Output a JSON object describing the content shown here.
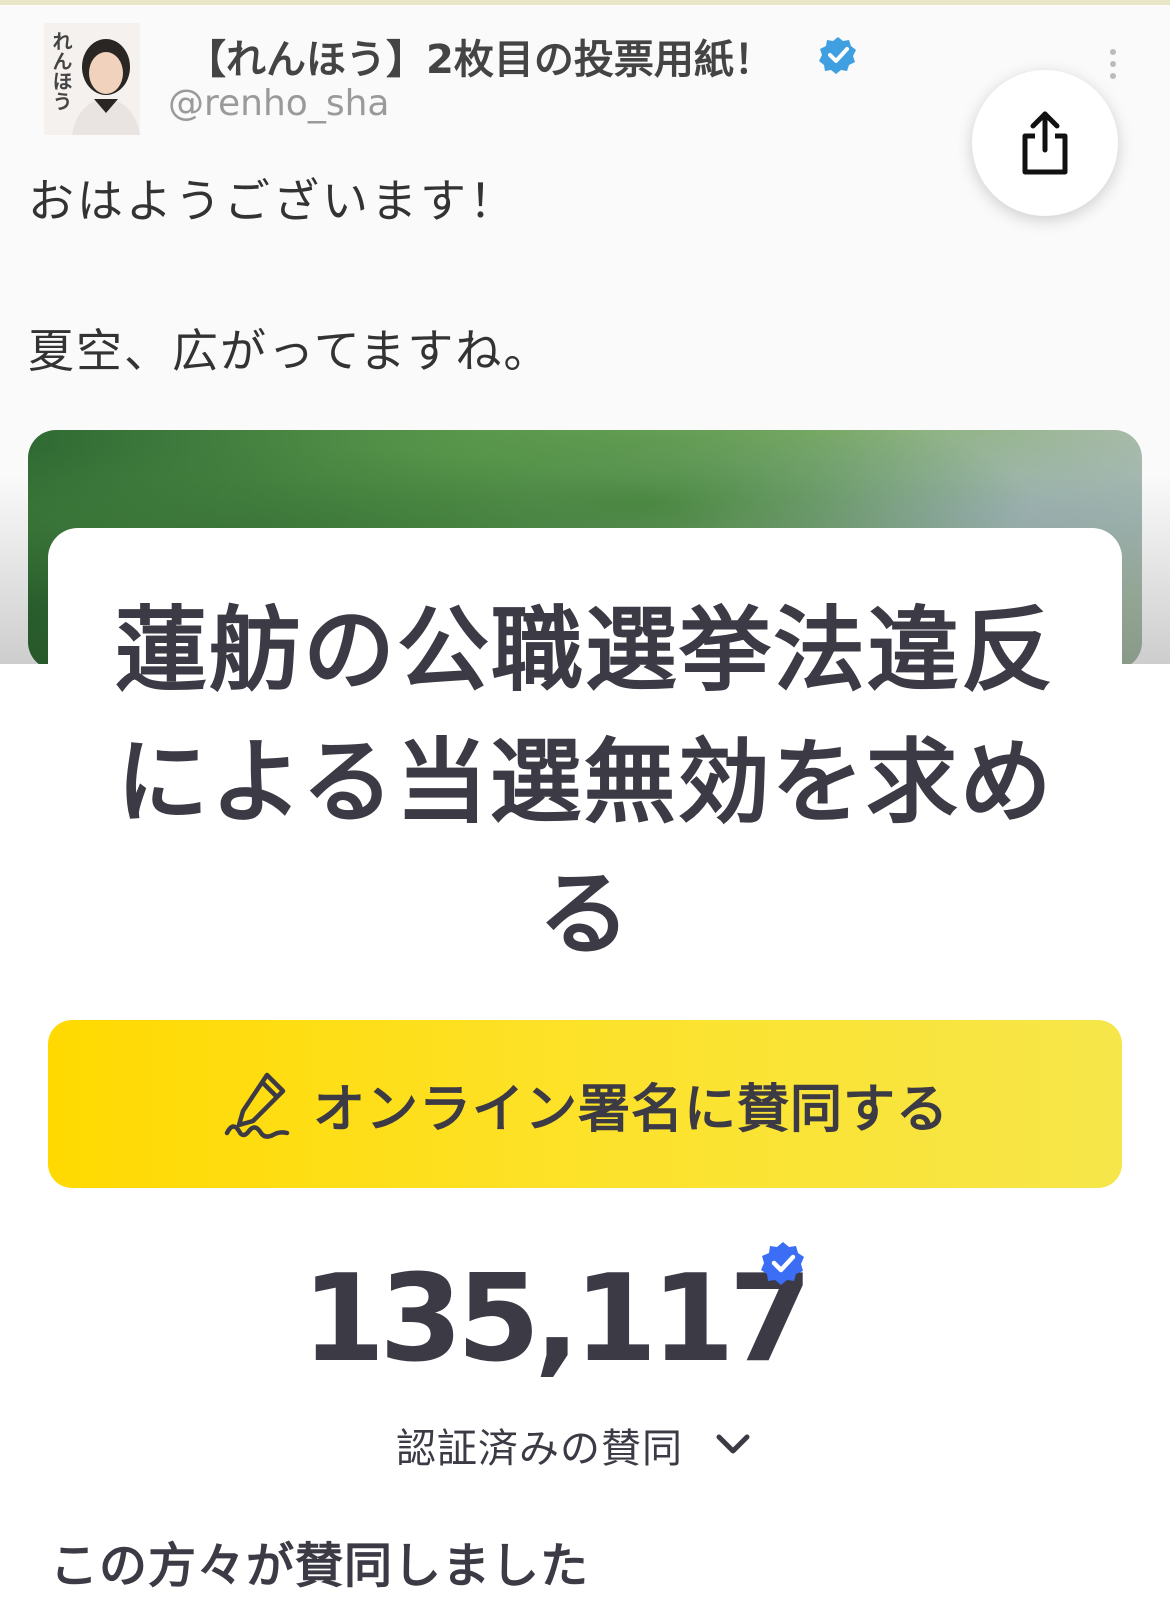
{
  "tweet": {
    "name": "【れんほう】2枚目の投票用紙！",
    "handle": "@renho_sha",
    "avatar_text": "れんほう",
    "line1": "おはようございます！",
    "line2": "夏空、広がってますね。"
  },
  "share": {
    "icon": "share-icon"
  },
  "petition": {
    "title": "蓮舫の公職選挙法違反による当選無効を求める",
    "sign_button": "オンライン署名に賛同する",
    "count": "135,117",
    "verified_label": "認証済みの賛同",
    "supporters_heading": "この方々が賛同しました"
  },
  "colors": {
    "accent_yellow": "#ffd900",
    "verified_blue": "#3b82f6",
    "text_dark": "#3b3a45"
  }
}
